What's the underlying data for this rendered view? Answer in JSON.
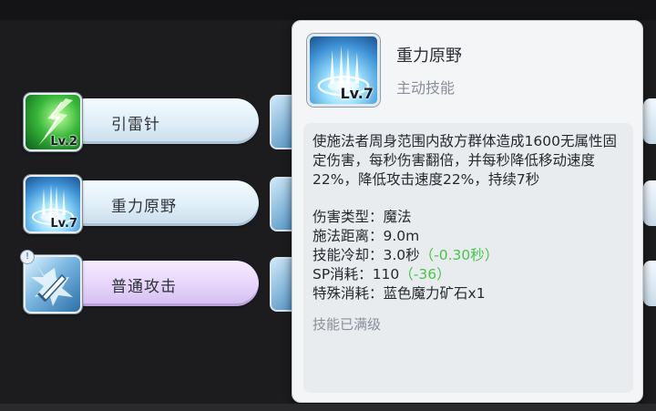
{
  "skills": [
    {
      "name": "引雷针",
      "level": "Lv.2",
      "icon": "lightning-rod-icon"
    },
    {
      "name": "重力原野",
      "level": "Lv.7",
      "icon": "gravity-field-icon"
    },
    {
      "name": "普通攻击",
      "level": "",
      "icon": "normal-attack-sword-icon",
      "badge": "!"
    }
  ],
  "tooltip": {
    "name": "重力原野",
    "level": "Lv.7",
    "type": "主动技能",
    "description": "使施法者周身范围内敌方群体造成1600无属性固定伤害，每秒伤害翻倍，并每秒降低移动速度22%，降低攻击速度22%，持续7秒",
    "stats": {
      "damage_type_label": "伤害类型：",
      "damage_type": "魔法",
      "range_label": "施法距离：",
      "range": "9.0m",
      "cooldown_label": "技能冷却：",
      "cooldown": "3.0秒",
      "cooldown_mod": "（-0.30秒）",
      "sp_label": "SP消耗：",
      "sp": "110",
      "sp_mod": "（-36）",
      "special_label": "特殊消耗：",
      "special": "蓝色魔力矿石x1"
    },
    "max_level_text": "技能已满级"
  },
  "colors": {
    "bonus_green": "#48c34a",
    "active_pill": "#e6d4fb",
    "pill": "#dfeef8"
  }
}
